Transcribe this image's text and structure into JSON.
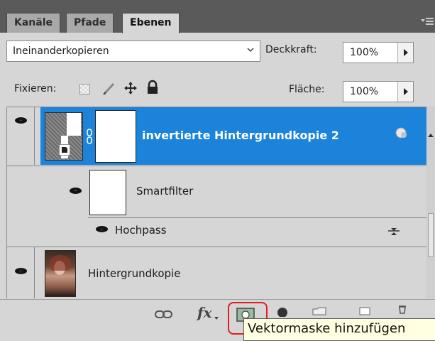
{
  "tabs": [
    {
      "label": "Kanäle",
      "active": false
    },
    {
      "label": "Pfade",
      "active": false
    },
    {
      "label": "Ebenen",
      "active": true
    }
  ],
  "blend_mode": {
    "value": "Ineinanderkopieren"
  },
  "opacity": {
    "label": "Deckkraft:",
    "value": "100%"
  },
  "lock": {
    "label": "Fixieren:"
  },
  "fill": {
    "label": "Fläche:",
    "value": "100%"
  },
  "layers": {
    "smart": {
      "name": "invertierte Hintergrundkopie 2",
      "selected": true
    },
    "smartfilter": {
      "name": "Smartfilter"
    },
    "hochpass": {
      "name": "Hochpass"
    },
    "background_copy": {
      "name": "Hintergrundkopie"
    }
  },
  "bottom_tools": {
    "link": "link-icon",
    "fx": "fx",
    "add_mask": "add-mask-icon"
  },
  "tooltip": {
    "text": "Vektormaske hinzufügen"
  },
  "colors": {
    "selected_row": "#1b83da",
    "tab_bar": "#5a5a5a",
    "panel": "#d6d6d6",
    "tooltip_bg": "#ffffe1",
    "highlight": "#e02020"
  }
}
